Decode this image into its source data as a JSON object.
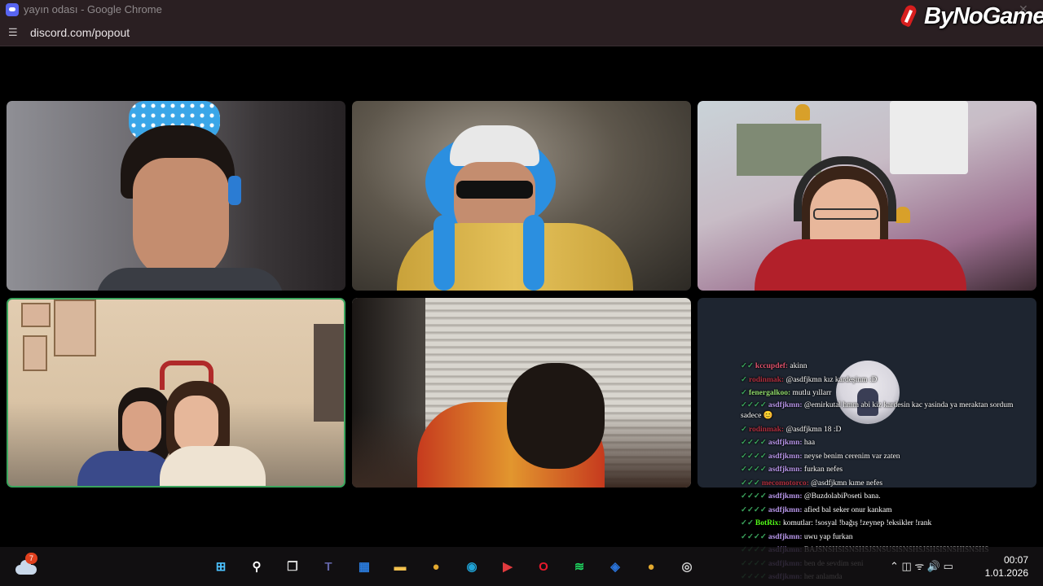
{
  "window": {
    "title": "yayın odası - Google Chrome",
    "url": "discord.com/popout",
    "close_glyph": "✕"
  },
  "logo": {
    "text": "ByNoGame"
  },
  "participants": [
    {
      "id": "tile-1",
      "description": "man with blue bow headband and headphones"
    },
    {
      "id": "tile-2",
      "description": "man with cap, sunglasses and blue octopus hat"
    },
    {
      "id": "tile-3",
      "description": "woman with headset and festive decorations"
    },
    {
      "id": "tile-4",
      "description": "two women with reindeer antlers",
      "speaking": true
    },
    {
      "id": "tile-5",
      "description": "person leaning forward in front of blinds"
    },
    {
      "id": "tile-6",
      "description": "stream chat overlay"
    }
  ],
  "chat": {
    "messages": [
      {
        "badges": "✓✓",
        "user": "kccupdef:",
        "user_color": "#e0536d",
        "text": " akinn"
      },
      {
        "badges": "✓",
        "user": "rodinmak:",
        "user_color": "#b03040",
        "text": " @asdfjkmn kız kardeşinm :D"
      },
      {
        "badges": "✓",
        "user": "fenergalkoo:",
        "user_color": "#8fd96b",
        "text": " mutlu yıllarr"
      },
      {
        "badges": "✓✓✓✓",
        "user": "asdfjkmn:",
        "user_color": "#b695e8",
        "text": " @emirkutal hmm abi kiz kardesin kac yasinda ya meraktan sordum sadece 😊",
        "wrap": true
      },
      {
        "badges": "✓",
        "user": "rodinmak:",
        "user_color": "#b03040",
        "text": " @asdfjkmn 18 :D"
      },
      {
        "badges": "✓✓✓✓",
        "user": "asdfjkmn:",
        "user_color": "#b695e8",
        "text": " haa"
      },
      {
        "badges": "✓✓✓✓",
        "user": "asdfjkmn:",
        "user_color": "#b695e8",
        "text": " neyse benim cerenim var zaten"
      },
      {
        "badges": "✓✓✓✓",
        "user": "asdfjkmn:",
        "user_color": "#b695e8",
        "text": " furkan nefes"
      },
      {
        "badges": "✓✓✓",
        "user": "mecomotorco:",
        "user_color": "#b03040",
        "text": " @asdfjkmn kıme nefes"
      },
      {
        "badges": "✓✓✓✓",
        "user": "asdfjkmn:",
        "user_color": "#b695e8",
        "text": " @BuzdolabiPoseti bana."
      },
      {
        "badges": "✓✓✓✓",
        "user": "asdfjkmn:",
        "user_color": "#b695e8",
        "text": " afied bal seker onur kankam"
      },
      {
        "badges": "✓✓",
        "user": "BotRix:",
        "user_color": "#53fc18",
        "text": " komutlar: !sosyal !bağış !zeynep !eksikler !rank"
      },
      {
        "badges": "✓✓✓✓",
        "user": "asdfjkmn:",
        "user_color": "#b695e8",
        "text": " uwu yap furkan"
      },
      {
        "badges": "✓✓✓✓",
        "user": "asdfjkmn:",
        "user_color": "#b695e8",
        "text": " BAJSNSHSISNSHSJSNSUSISNSHSJSHSISNSHISNSHS"
      },
      {
        "badges": "✓✓✓✓",
        "user": "asdfjkmn:",
        "user_color": "#b695e8",
        "text": " ben de sevdim seni"
      },
      {
        "badges": "✓✓✓✓",
        "user": "asdfjkmn:",
        "user_color": "#b695e8",
        "text": " her anlamda"
      }
    ]
  },
  "taskbar": {
    "weather_badge": "7",
    "apps": [
      {
        "name": "start-icon",
        "glyph": "⊞",
        "color": "#4cc2ff"
      },
      {
        "name": "search-icon",
        "glyph": "⚲",
        "color": "#ffffff"
      },
      {
        "name": "task-view-icon",
        "glyph": "❐",
        "color": "#d8d8d8"
      },
      {
        "name": "teams-icon",
        "glyph": "T",
        "color": "#6264a7"
      },
      {
        "name": "store-icon",
        "glyph": "▦",
        "color": "#2b7de0"
      },
      {
        "name": "file-explorer-icon",
        "glyph": "▬",
        "color": "#f2c14e"
      },
      {
        "name": "chrome-icon",
        "glyph": "●",
        "color": "#e3a92f"
      },
      {
        "name": "edge-icon",
        "glyph": "◉",
        "color": "#1fa3d6"
      },
      {
        "name": "media-player-icon",
        "glyph": "▶",
        "color": "#e03a3e"
      },
      {
        "name": "opera-icon",
        "glyph": "O",
        "color": "#e8192c"
      },
      {
        "name": "spotify-icon",
        "glyph": "≋",
        "color": "#1ed760"
      },
      {
        "name": "vpn-icon",
        "glyph": "◈",
        "color": "#2a73d9"
      },
      {
        "name": "chrome-active-icon",
        "glyph": "●",
        "color": "#e3a92f"
      },
      {
        "name": "obs-icon",
        "glyph": "◎",
        "color": "#d0d0d0"
      }
    ],
    "tray_glyphs": "⌃  ◫  ᯤ  🔊  ▭",
    "time": "00:07",
    "date": "1.01.2026"
  },
  "colors": {
    "speaking_border": "#3ba55d",
    "accent": "#5865f2"
  }
}
